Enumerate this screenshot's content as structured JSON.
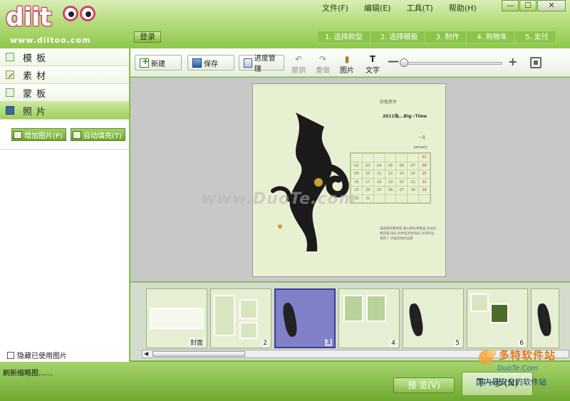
{
  "app": {
    "logo_text": "diit",
    "url": "www.diitoo.com",
    "login_label": "登录"
  },
  "menu": [
    "文件(F)",
    "编辑(E)",
    "工具(T)",
    "帮助(H)"
  ],
  "window_controls": [
    "—",
    "☐",
    "✕"
  ],
  "steps": [
    "1. 选择款型",
    "2. 选择模板",
    "3. 制作",
    "4. 购物车",
    "5. 支付"
  ],
  "sidebar": {
    "items": [
      {
        "label": "模板",
        "icon": "template-icon"
      },
      {
        "label": "素材",
        "icon": "material-icon"
      },
      {
        "label": "蒙板",
        "icon": "mask-icon"
      },
      {
        "label": "照片",
        "icon": "photo-icon",
        "active": true
      }
    ],
    "add_photo_label": "增加图片(P)",
    "auto_fill_label": "自动填充(T)",
    "hide_used_label": "隐藏已使用图片"
  },
  "toolbar": {
    "new_label": "新建",
    "save_label": "保存",
    "progress_label": "进度管理",
    "undo_label": "撤销",
    "redo_label": "重做",
    "picture_label": "图片",
    "text_label": "文字",
    "text_icon_glyph": "T",
    "zoom_minus": "—",
    "zoom_plus": "+"
  },
  "canvas": {
    "page_header": "卯兔贺岁",
    "page_year": "2011兔...Big~Time",
    "cal_month_cn": "一月",
    "cal_month_en": "January",
    "calendar_rows": [
      [
        "",
        "",
        "",
        "",
        "",
        "",
        "01"
      ],
      [
        "02",
        "03",
        "04",
        "05",
        "06",
        "07",
        "08"
      ],
      [
        "09",
        "10",
        "11",
        "12",
        "13",
        "14",
        "15"
      ],
      [
        "16",
        "17",
        "18",
        "19",
        "20",
        "21",
        "22"
      ],
      [
        "23",
        "24",
        "25",
        "26",
        "27",
        "28",
        "29"
      ],
      [
        "30",
        "31",
        "",
        "",
        "",
        "",
        ""
      ]
    ],
    "verse": "道是春风看更新,看山明水秀看画,花似好春回来,快乐,时时是无忧快乐,今年好运来到了,幸福吉祥好运来",
    "watermark": "www.DuoTe.com"
  },
  "thumbnails": [
    {
      "label": "封面"
    },
    {
      "label": "2"
    },
    {
      "label": "3",
      "selected": true
    },
    {
      "label": "4"
    },
    {
      "label": "5"
    },
    {
      "label": "6"
    },
    {
      "label": ""
    }
  ],
  "statusbar": {
    "status_text": "刷新缩略图……",
    "preview_label": "预 览(V)",
    "next_label": "下一步(N)",
    "site_name": "多特软件站",
    "site_url": "DuoTe.Com",
    "site_desc": "国内最安全的软件站"
  }
}
